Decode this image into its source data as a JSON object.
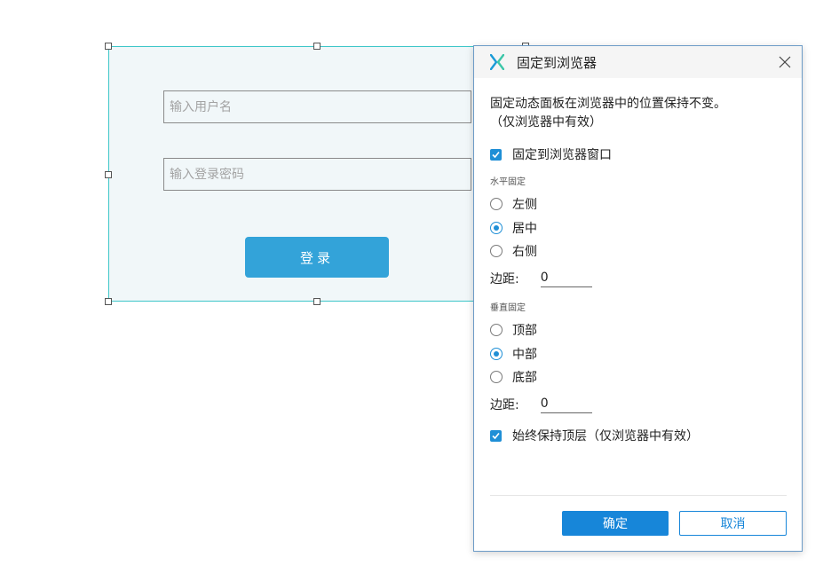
{
  "login_panel": {
    "username_placeholder": "输入用户名",
    "password_placeholder": "输入登录密码",
    "login_button": "登录"
  },
  "dialog": {
    "title": "固定到浏览器",
    "app_icon": "axure-x-icon",
    "description_line1": "固定动态面板在浏览器中的位置保持不变。",
    "description_line2": "（仅浏览器中有效）",
    "pin_to_browser": {
      "label": "固定到浏览器窗口",
      "checked": true
    },
    "horizontal": {
      "section_label": "水平固定",
      "options": [
        {
          "label": "左侧",
          "selected": false
        },
        {
          "label": "居中",
          "selected": true
        },
        {
          "label": "右侧",
          "selected": false
        }
      ],
      "margin_label": "边距:",
      "margin_value": "0"
    },
    "vertical": {
      "section_label": "垂直固定",
      "options": [
        {
          "label": "顶部",
          "selected": false
        },
        {
          "label": "中部",
          "selected": true
        },
        {
          "label": "底部",
          "selected": false
        }
      ],
      "margin_label": "边距:",
      "margin_value": "0"
    },
    "always_on_top": {
      "label": "始终保持顶层（仅浏览器中有效）",
      "checked": true
    },
    "ok_button": "确定",
    "cancel_button": "取消"
  },
  "colors": {
    "accent": "#1786d9",
    "login_button": "#33a3d9",
    "panel_background": "#f1f7f9",
    "selection_border": "#3cc6c8"
  }
}
